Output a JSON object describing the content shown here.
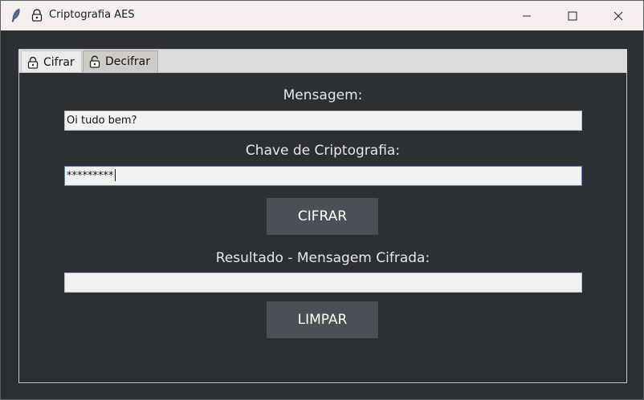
{
  "window": {
    "title": "Criptografia AES"
  },
  "tabs": [
    {
      "label": "Cifrar",
      "selected": true,
      "icon": "lock-closed-icon"
    },
    {
      "label": "Decifrar",
      "selected": false,
      "icon": "lock-open-icon"
    }
  ],
  "form": {
    "message_label": "Mensagem:",
    "message_value": "Oi tudo bem?",
    "key_label": "Chave de Criptografia:",
    "key_value": "*********",
    "encrypt_button": "CIFRAR",
    "result_label": "Resultado - Mensagem Cifrada:",
    "result_value": "",
    "clear_button": "LIMPAR"
  },
  "colors": {
    "background": "#2c2f33",
    "button": "#4b4f56",
    "focus_border": "#4b89c9"
  }
}
